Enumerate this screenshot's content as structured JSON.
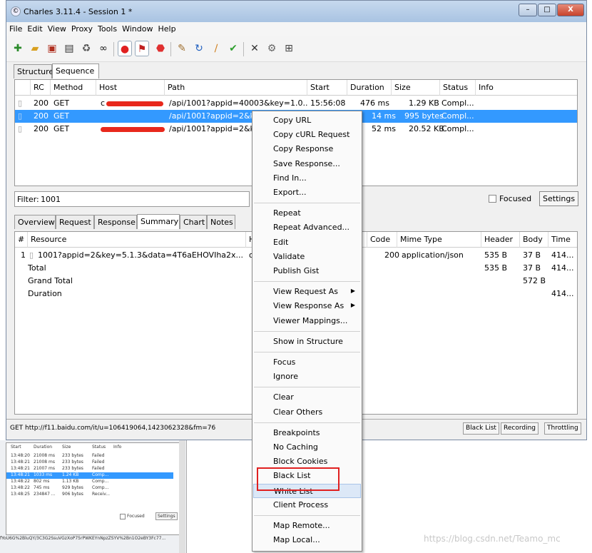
{
  "window": {
    "title": "Charles 3.11.4 - Session 1 *",
    "min_label": "–",
    "max_label": "□",
    "close_label": "X"
  },
  "menu": [
    "File",
    "Edit",
    "View",
    "Proxy",
    "Tools",
    "Window",
    "Help"
  ],
  "view_tabs": [
    "Structure",
    "Sequence"
  ],
  "table": {
    "headers": [
      "RC",
      "Method",
      "Host",
      "Path",
      "Start",
      "Duration",
      "Size",
      "Status",
      "Info"
    ],
    "rows": [
      {
        "rc": "200",
        "method": "GET",
        "host": "c",
        "path": "/api/1001?appid=40003&key=1.0...",
        "start": "15:56:08",
        "duration": "476 ms",
        "size": "1.29 KB",
        "status": "Compl..."
      },
      {
        "rc": "200",
        "method": "GET",
        "host": "",
        "path": "/api/1001?appid=2&k",
        "start": "",
        "duration": "14 ms",
        "size": "995 bytes",
        "status": "Compl..."
      },
      {
        "rc": "200",
        "method": "GET",
        "host": "",
        "path": "/api/1001?appid=2&k",
        "start": "",
        "duration": "52 ms",
        "size": "20.52 KB",
        "status": "Compl..."
      }
    ]
  },
  "filter": {
    "label": "Filter:",
    "value": "1001",
    "focused_label": "Focused",
    "settings_label": "Settings"
  },
  "detail_tabs": [
    "Overview",
    "Request",
    "Response",
    "Summary",
    "Chart",
    "Notes"
  ],
  "summary": {
    "headers": [
      "#",
      "Resource",
      "Ho",
      "Code",
      "Mime Type",
      "Header",
      "Body",
      "Time"
    ],
    "rows": [
      {
        "num": "1",
        "resource": "1001?appid=2&key=5.1.3&data=4T6aEHOVIha2x...",
        "host": "oc",
        "code": "200",
        "mime": "application/json",
        "header": "535 B",
        "body": "37 B",
        "time": "414..."
      },
      {
        "num": "",
        "resource": "Total",
        "host": "",
        "code": "",
        "mime": "",
        "header": "535 B",
        "body": "37 B",
        "time": "414..."
      },
      {
        "num": "",
        "resource": "Grand Total",
        "host": "",
        "code": "",
        "mime": "",
        "header": "",
        "body": "572 B",
        "time": ""
      },
      {
        "num": "",
        "resource": "Duration",
        "host": "",
        "code": "",
        "mime": "",
        "header": "",
        "body": "",
        "time": "414..."
      }
    ]
  },
  "status": {
    "text": "GET http://f11.baidu.com/it/u=106419064,1423062328&fm=76",
    "buttons": [
      "Black List",
      "Recording",
      "Throttling"
    ]
  },
  "context_menu": {
    "groups": [
      [
        "Copy URL",
        "Copy cURL Request",
        "Copy Response",
        "Save Response...",
        "Find In...",
        "Export..."
      ],
      [
        "Repeat",
        "Repeat Advanced...",
        "Edit",
        "Validate",
        "Publish Gist"
      ],
      [
        "View Request As",
        "View Response As",
        "Viewer Mappings..."
      ],
      [
        "Show in Structure"
      ],
      [
        "Focus",
        "Ignore"
      ],
      [
        "Clear",
        "Clear Others"
      ],
      [
        "Breakpoints",
        "No Caching",
        "Block Cookies",
        "Black List",
        "White List",
        "Client Process"
      ],
      [
        "Map Remote...",
        "Map Local..."
      ]
    ]
  },
  "background_window": {
    "headers": [
      "Start",
      "Duration",
      "Size",
      "Status",
      "Info"
    ],
    "rows": [
      [
        "13:48:20",
        "21008 ms",
        "233 bytes",
        "Failed"
      ],
      [
        "13:48:21",
        "21008 ms",
        "233 bytes",
        "Failed"
      ],
      [
        "13:48:21",
        "21007 ms",
        "233 bytes",
        "Failed"
      ],
      [
        "13:48:21",
        "1033 ms",
        "1.24 KB",
        "Comp..."
      ],
      [
        "13:48:22",
        "802 ms",
        "1.13 KB",
        "Comp..."
      ],
      [
        "13:48:22",
        "745 ms",
        "929 bytes",
        "Comp..."
      ],
      [
        "13:48:25",
        "234847 ...",
        "906 bytes",
        "Receiv..."
      ]
    ],
    "focused_label": "Focused",
    "settings_label": "Settings",
    "url_text": "fYoU6G%2BluQY/3C3G2SsuVGzXoP75rPWKEYnNpzZSYV%2Bn1O2eBY3Fc77..."
  },
  "watermark": "https://blog.csdn.net/Teamo_mc",
  "colors": {
    "selection": "#3399ff",
    "highlight_box": "#e02020",
    "redaction": "#e8281c"
  }
}
